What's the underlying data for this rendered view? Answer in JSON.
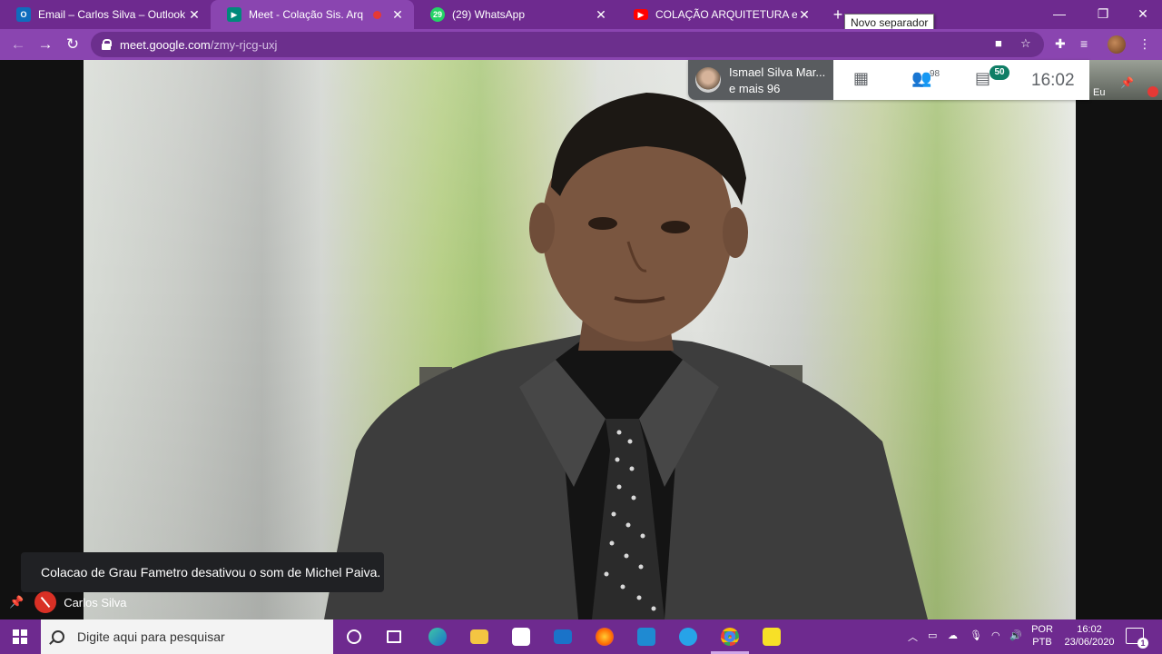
{
  "browser": {
    "tabs": [
      {
        "title": "Email – Carlos Silva – Outlook",
        "favicon": "outlook-icon",
        "favicon_color": "#0f6cbd",
        "active": false
      },
      {
        "title": "Meet - Colação Sis. Arq",
        "favicon": "meet-icon",
        "favicon_color": "#00897b",
        "active": true,
        "recording": true
      },
      {
        "title": "(29) WhatsApp",
        "favicon": "whatsapp-icon",
        "favicon_color": "#25d366",
        "badge": "29",
        "active": false
      },
      {
        "title": "COLAÇÃO ARQUITETURA e SISTE",
        "favicon": "youtube-icon",
        "favicon_color": "#ff0000",
        "active": false
      }
    ],
    "new_tab_tooltip": "Novo separador",
    "url_host": "meet.google.com",
    "url_path": "/zmy-rjcg-uxj",
    "theme_color": "#6e2a8f"
  },
  "meet": {
    "active_speaker": {
      "name": "Ismael Silva Mar...",
      "others": "e mais 96"
    },
    "participants_count": "98",
    "chat_count": "50",
    "time": "16:02",
    "self_label": "Eu",
    "toast": "Colacao de Grau Fametro desativou o som de Michel Paiva.",
    "presenter_name": "Carlos Silva"
  },
  "taskbar": {
    "search_placeholder": "Digite aqui para pesquisar",
    "apps": [
      "task-view",
      "edge",
      "file-explorer",
      "store",
      "mail",
      "firefox",
      "vscode",
      "edge-dev",
      "chrome",
      "sticky-notes"
    ],
    "language": "POR",
    "layout": "PTB",
    "time": "16:02",
    "date": "23/06/2020",
    "notification_count": "1"
  }
}
